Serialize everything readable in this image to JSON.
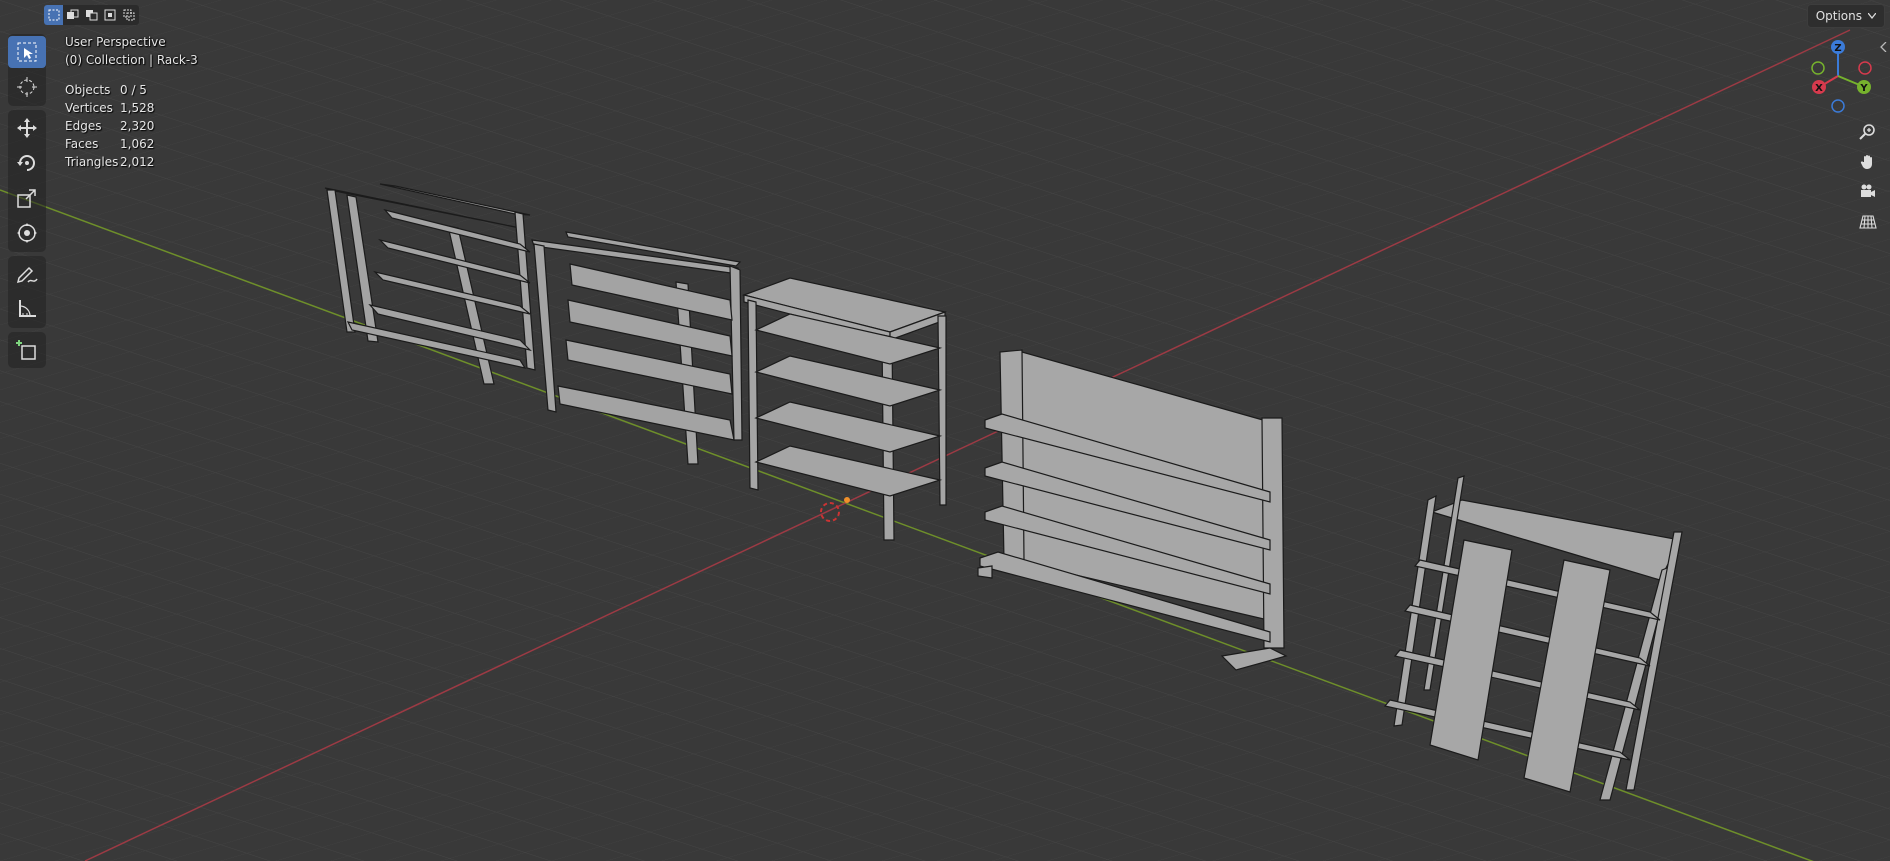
{
  "viewport": {
    "view_name": "User Perspective",
    "collection_line": "(0) Collection | Rack-3",
    "options_label": "Options"
  },
  "stats": [
    {
      "label": "Objects",
      "value": "0 / 5"
    },
    {
      "label": "Vertices",
      "value": "1,528"
    },
    {
      "label": "Edges",
      "value": "2,320"
    },
    {
      "label": "Faces",
      "value": "1,062"
    },
    {
      "label": "Triangles",
      "value": "2,012"
    }
  ],
  "gizmo": {
    "z_label": "Z",
    "x_label": "X",
    "y_label": "Y"
  },
  "toolbar": {
    "tools": [
      "select-box-icon",
      "cursor-icon",
      "move-icon",
      "rotate-icon",
      "scale-icon",
      "transform-icon",
      "annotate-icon",
      "measure-icon",
      "add-cube-icon"
    ]
  },
  "colors": {
    "background": "#393939",
    "grid": "#454545",
    "x_axis": "#9c3a44",
    "y_axis": "#6e8f2a",
    "active_tool": "#4772b3",
    "object_fill": "#a9a9a9",
    "object_edge": "#1a1a1a"
  }
}
